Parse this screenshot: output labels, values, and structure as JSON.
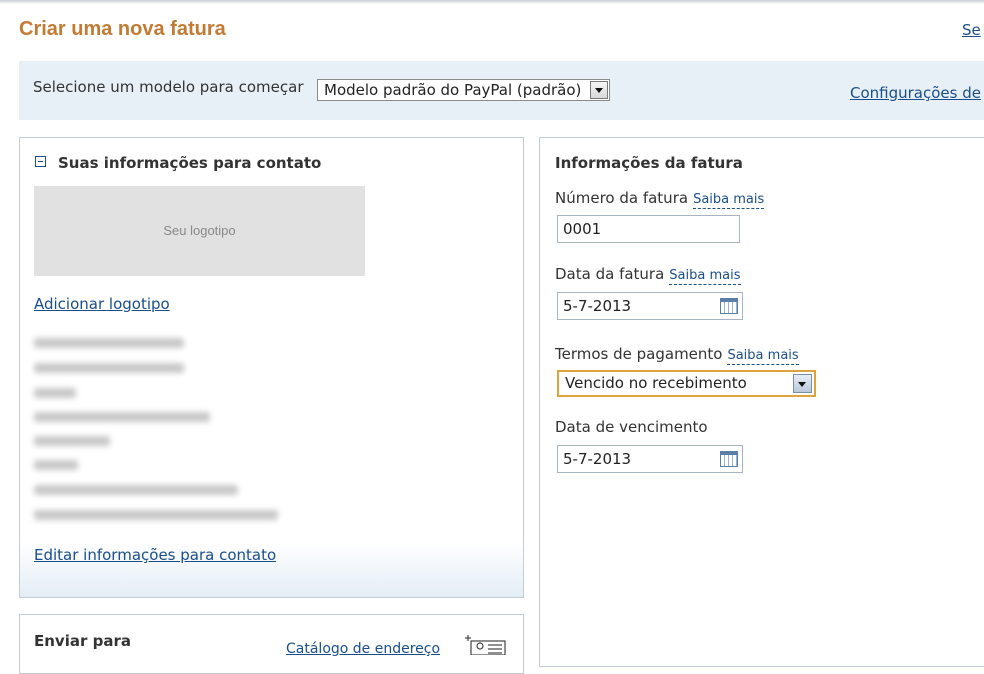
{
  "header": {
    "title": "Criar uma nova fatura",
    "top_right_link": "Se"
  },
  "template": {
    "label": "Selecione um modelo para começar",
    "selected": "Modelo padrão do PayPal (padrão)",
    "settings_link": "Configurações de"
  },
  "contact": {
    "title": "Suas informações para contato",
    "logo_placeholder": "Seu logotipo",
    "add_logo_link": "Adicionar logotipo",
    "edit_link": "Editar informações para contato"
  },
  "invoice": {
    "title": "Informações da fatura",
    "learn_more": "Saiba mais",
    "number_label": "Número da fatura",
    "number_value": "0001",
    "date_label": "Data da fatura",
    "date_value": "5-7-2013",
    "terms_label": "Termos de pagamento",
    "terms_value": "Vencido no recebimento",
    "due_label": "Data de vencimento",
    "due_value": "5-7-2013"
  },
  "send": {
    "title": "Enviar para",
    "address_book_link": "Catálogo de endereço"
  },
  "icons": {
    "collapse": "collapse-minus-icon",
    "calendar": "calendar-icon",
    "address_book": "address-book-icon"
  },
  "colors": {
    "title": "#c47a32",
    "link": "#1a4e8a",
    "focus_border": "#e0a33c",
    "template_bar": "#e8f0f7"
  }
}
